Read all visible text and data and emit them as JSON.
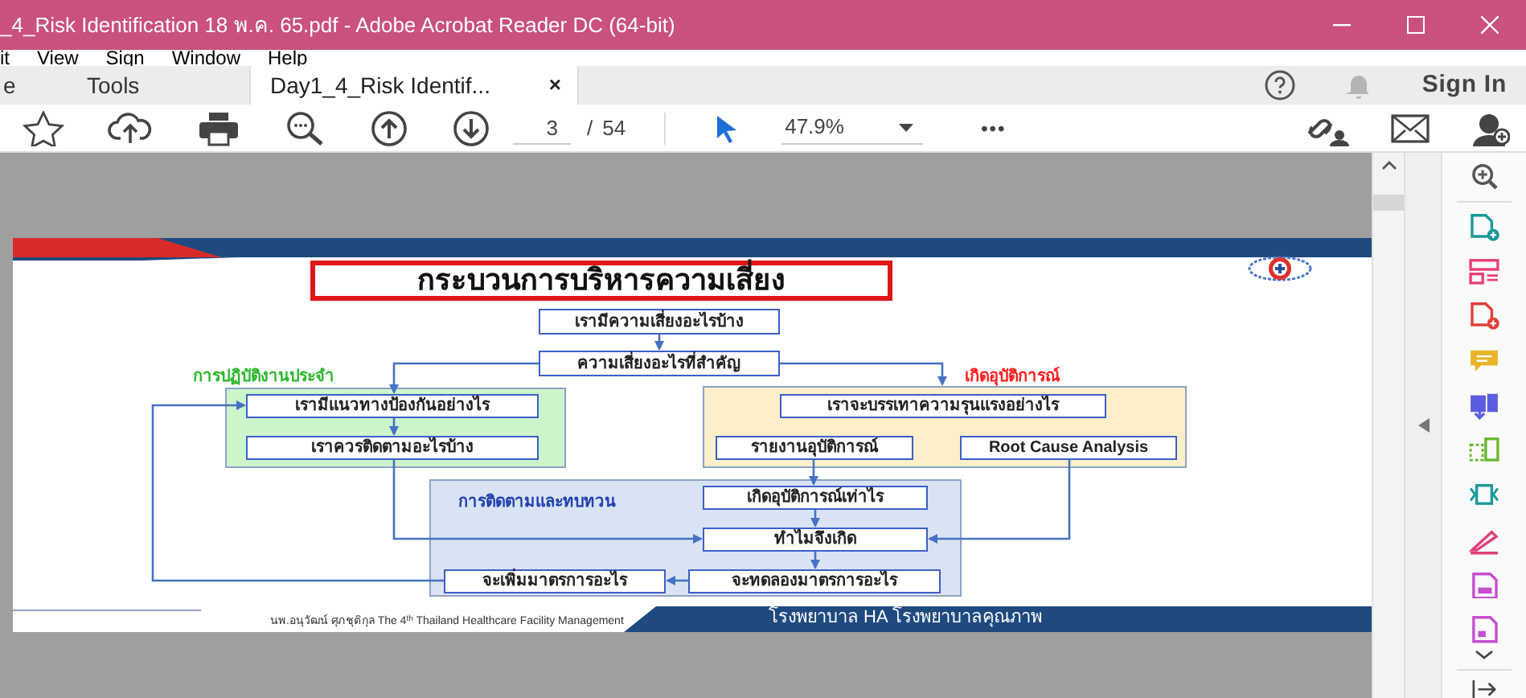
{
  "window": {
    "title": "_4_Risk Identification 18 พ.ค. 65.pdf - Adobe Acrobat Reader DC (64-bit)"
  },
  "menu": [
    "it",
    "View",
    "Sign",
    "Window",
    "Help"
  ],
  "tabs": [
    {
      "label": "e",
      "selected": false
    },
    {
      "label": "Tools",
      "selected": false
    },
    {
      "label": "Day1_4_Risk Identif...",
      "selected": true,
      "close": "×"
    }
  ],
  "header_right": {
    "sign_in": "Sign In"
  },
  "toolbar": {
    "page": "3",
    "separator": "/",
    "page_count": "54",
    "zoom": "47.9%",
    "more": "•••"
  },
  "slide": {
    "title": "กระบวนการบริหารความเสี่ยง",
    "panel_labels": [
      "การปฏิบัติงานประจำ",
      "เกิดอุบัติการณ์",
      "การติดตามและทบทวน"
    ],
    "steps": [
      "เรามีความเสี่ยงอะไรบ้าง",
      "ความเสี่ยงอะไรที่สำคัญ",
      "เรามีแนวทางป้องกันอย่างไร",
      "เราควรติดตามอะไรบ้าง",
      "เราจะบรรเทาความรุนแรงอย่างไร",
      "รายงานอุบัติการณ์",
      "Root Cause Analysis",
      "เกิดอุบัติการณ์เท่าไร",
      "ทำไมจึงเกิด",
      "จะเพิ่มมาตรการอะไร",
      "จะทดลองมาตรการอะไร"
    ],
    "footer_author": "นพ.อนุวัฒน์ ศุภชุติกุล  The 4",
    "footer_sup": "th",
    "footer_event": " Thailand Healthcare Facility Management",
    "footer_banner": "โรงพยาบาล HA โรงพยาบาลคุณภาพ"
  }
}
